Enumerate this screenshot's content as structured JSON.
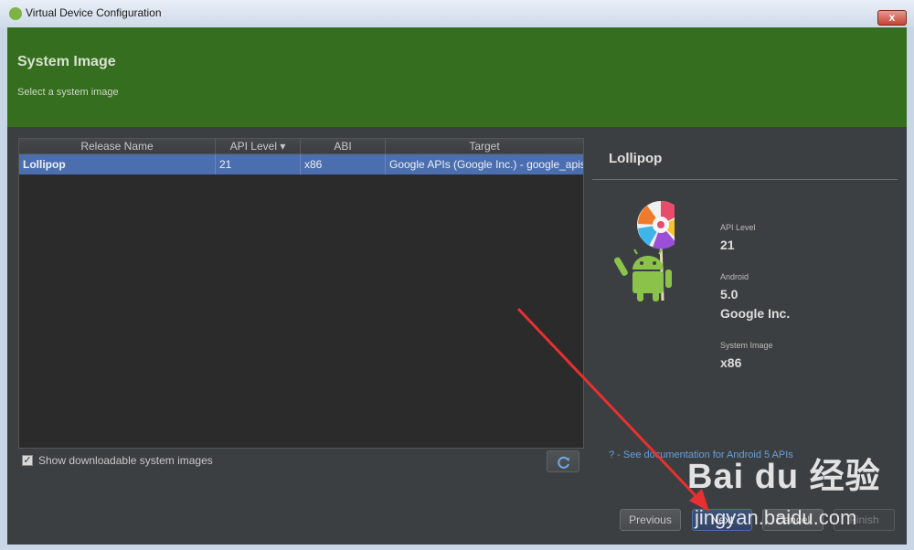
{
  "window": {
    "title": "Virtual Device Configuration",
    "close_label": "x"
  },
  "header": {
    "title": "System Image",
    "subtitle": "Select a system image"
  },
  "table": {
    "columns": [
      "Release Name",
      "API Level ▾",
      "ABI",
      "Target"
    ],
    "rows": [
      {
        "release": "Lollipop",
        "api": "21",
        "abi": "x86",
        "target": "Google APIs (Google Inc.) - google_apis"
      }
    ]
  },
  "options": {
    "show_downloadable_label": "Show downloadable system images",
    "show_downloadable_checked": true
  },
  "details": {
    "name": "Lollipop",
    "api_level_label": "API Level",
    "api_level_value": "21",
    "android_label": "Android",
    "android_version": "5.0",
    "vendor": "Google Inc.",
    "system_image_label": "System Image",
    "system_image_value": "x86",
    "doc_link": "? - See documentation for Android 5 APIs"
  },
  "buttons": {
    "previous": "Previous",
    "next": "Next",
    "cancel": "Cancel",
    "finish": "Finish"
  },
  "watermark": {
    "brand": "Bai du 经验",
    "url": "jingyan.baidu.com"
  },
  "colors": {
    "header_green": "#356e1f",
    "selection_blue": "#4b6eaf",
    "annotation_red": "#e83030",
    "link_blue": "#6a9ed8"
  }
}
